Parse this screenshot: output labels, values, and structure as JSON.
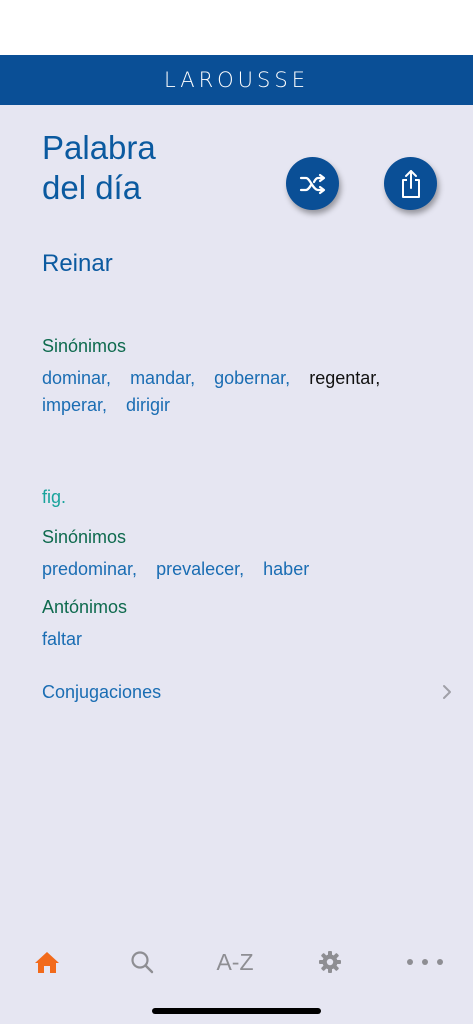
{
  "header": {
    "brand": "LAROUSSE"
  },
  "page": {
    "title_line1": "Palabra",
    "title_line2": "del día"
  },
  "actions": {
    "shuffle_icon": "shuffle-icon",
    "share_icon": "share-icon"
  },
  "entry": {
    "headword": "Reinar",
    "sense1": {
      "synonyms_label": "Sinónimos",
      "synonyms": [
        "dominar,",
        "mandar,",
        "gobernar,",
        "regentar,",
        "imperar,",
        "dirigir"
      ]
    },
    "fig_label": "fig.",
    "sense2": {
      "synonyms_label": "Sinónimos",
      "synonyms": [
        "predominar,",
        "prevalecer,",
        "haber"
      ],
      "antonyms_label": "Antónimos",
      "antonyms": [
        "faltar"
      ]
    },
    "conjugations_label": "Conjugaciones"
  },
  "tabbar": {
    "home_icon": "home-icon",
    "search_icon": "search-icon",
    "az_label": "A-Z",
    "settings_icon": "gear-icon",
    "more_icon": "more-icon"
  },
  "colors": {
    "brand_blue": "#0a4f96",
    "link_blue": "#1a6db3",
    "section_green": "#0e6a4e",
    "fig_teal": "#19a39c",
    "active_tab": "#f26a1b",
    "inactive_tab": "#8e8e93",
    "background": "#e6e6f2"
  }
}
